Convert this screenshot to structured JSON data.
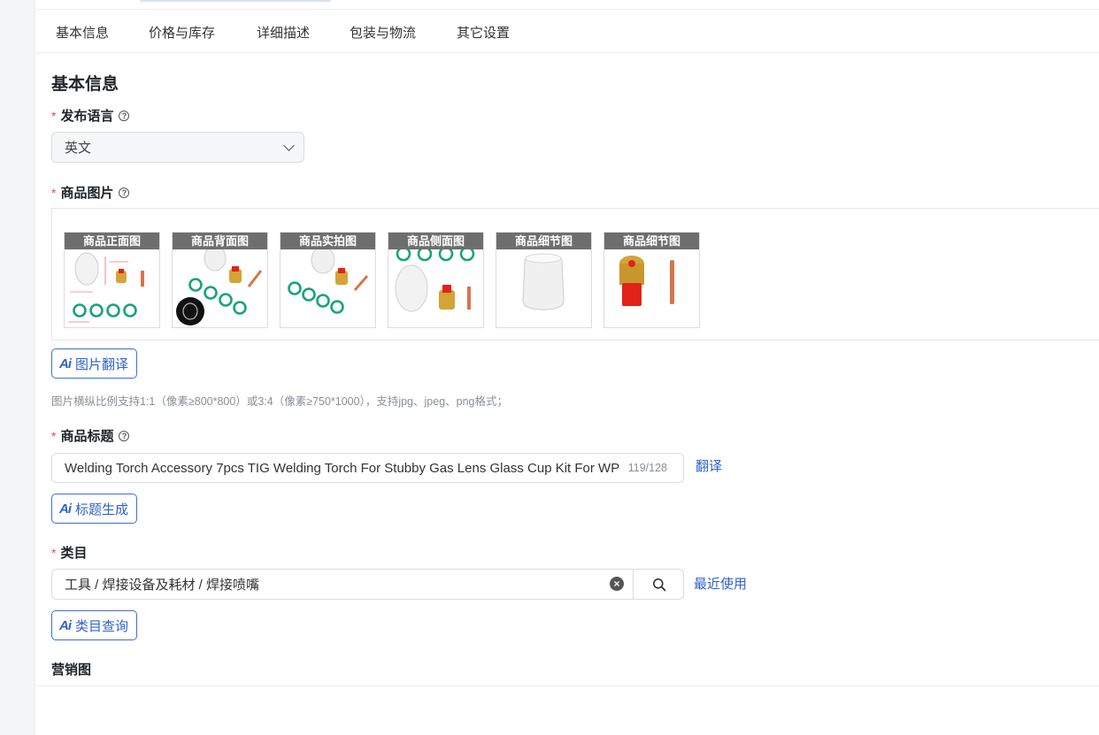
{
  "tabs": [
    "基本信息",
    "价格与库存",
    "详细描述",
    "包装与物流",
    "其它设置"
  ],
  "section_title": "基本信息",
  "language": {
    "required_mark": "*",
    "label": "发布语言",
    "help_icon": "question-circle-icon",
    "help_glyph": "?",
    "value": "英文"
  },
  "images": {
    "required_mark": "*",
    "label": "商品图片",
    "help_icon": "question-circle-icon",
    "help_glyph": "?",
    "items": [
      {
        "caption": "商品正面图"
      },
      {
        "caption": "商品背面图"
      },
      {
        "caption": "商品实拍图"
      },
      {
        "caption": "商品侧面图"
      },
      {
        "caption": "商品细节图"
      },
      {
        "caption": "商品细节图"
      }
    ],
    "ai_icon": "Ai",
    "translate_button": "图片翻译",
    "note": "图片横纵比例支持1:1（像素≥800*800）或3:4（像素≥750*1000），支持jpg、jpeg、png格式；"
  },
  "product_title": {
    "required_mark": "*",
    "label": "商品标题",
    "help_icon": "question-circle-icon",
    "help_glyph": "?",
    "value": "Welding Torch Accessory 7pcs TIG Welding Torch For Stubby Gas Lens Glass Cup Kit For WP",
    "counter": "119/128",
    "translate_link": "翻译",
    "ai_icon": "Ai",
    "generate_button": "标题生成"
  },
  "category": {
    "required_mark": "*",
    "label": "类目",
    "value": "工具 / 焊接设备及耗材 / 焊接喷嘴",
    "clear_glyph": "×",
    "recent_link": "最近使用",
    "ai_icon": "Ai",
    "query_button": "类目查询"
  },
  "marketing": {
    "label": "营销图"
  },
  "colors": {
    "accent": "#2f62cc",
    "required": "#e34d59",
    "ring_green": "#1aa37a",
    "brass": "#d4a437",
    "copper": "#d9744a",
    "insulator_red": "#e2231a"
  }
}
